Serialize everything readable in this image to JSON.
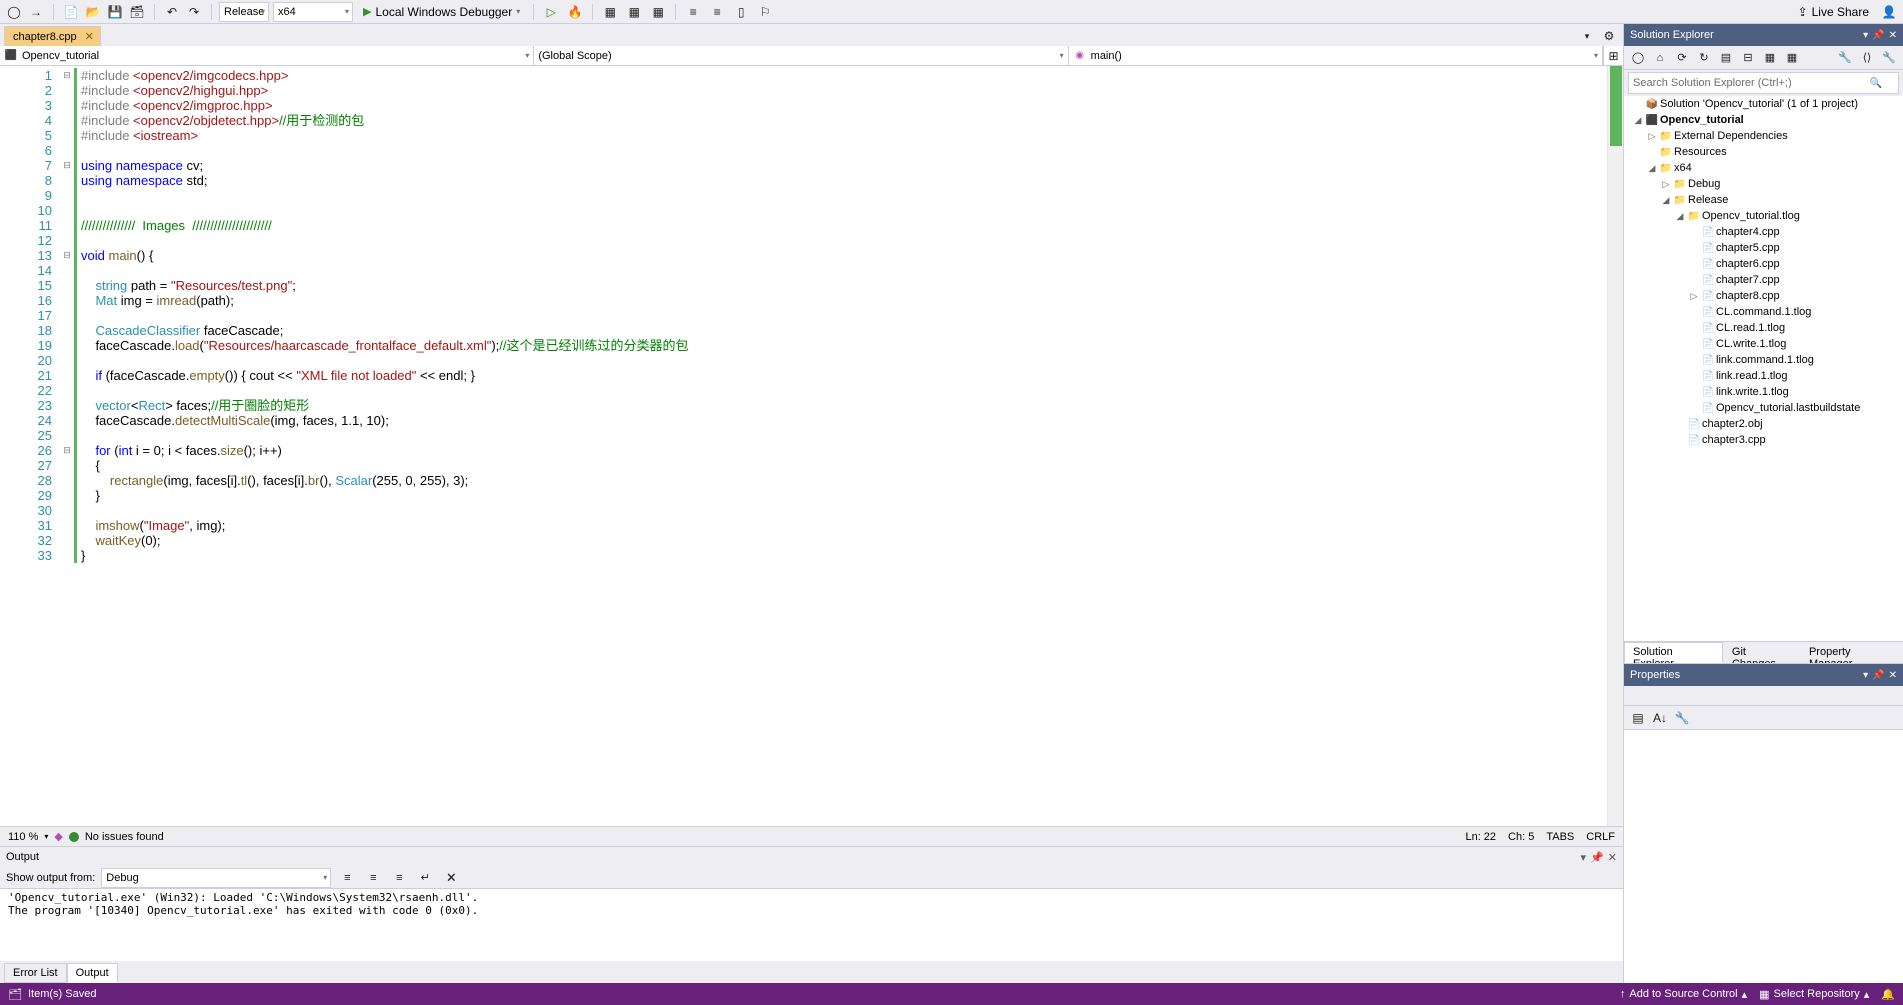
{
  "toolbar": {
    "config": "Release",
    "platform": "x64",
    "debugger_label": "Local Windows Debugger",
    "live_share": "Live Share"
  },
  "tabs": {
    "active_file": "chapter8.cpp"
  },
  "context": {
    "project": "Opencv_tutorial",
    "scope": "(Global Scope)",
    "function": "main()"
  },
  "code": {
    "lines": [
      {
        "n": 1,
        "fold": "⊟",
        "html": "<span class='kw-gray'>#include </span><span class='kw-str'>&lt;opencv2/imgcodecs.hpp&gt;</span>"
      },
      {
        "n": 2,
        "fold": "",
        "html": "<span class='kw-gray'>#include </span><span class='kw-str'>&lt;opencv2/highgui.hpp&gt;</span>"
      },
      {
        "n": 3,
        "fold": "",
        "html": "<span class='kw-gray'>#include </span><span class='kw-str'>&lt;opencv2/imgproc.hpp&gt;</span>"
      },
      {
        "n": 4,
        "fold": "",
        "html": "<span class='kw-gray'>#include </span><span class='kw-str'>&lt;opencv2/objdetect.hpp&gt;</span><span class='kw-comment'>//用于检测的包</span>"
      },
      {
        "n": 5,
        "fold": "",
        "html": "<span class='kw-gray'>#include </span><span class='kw-str'>&lt;iostream&gt;</span>"
      },
      {
        "n": 6,
        "fold": "",
        "html": ""
      },
      {
        "n": 7,
        "fold": "⊟",
        "html": "<span class='kw-blue'>using namespace</span> cv;"
      },
      {
        "n": 8,
        "fold": "",
        "html": "<span class='kw-blue'>using namespace</span> std;"
      },
      {
        "n": 9,
        "fold": "",
        "html": ""
      },
      {
        "n": 10,
        "fold": "",
        "html": ""
      },
      {
        "n": 11,
        "fold": "",
        "html": "<span class='kw-comment'>///////////////  Images  //////////////////////</span>"
      },
      {
        "n": 12,
        "fold": "",
        "html": ""
      },
      {
        "n": 13,
        "fold": "⊟",
        "html": "<span class='kw-blue'>void</span> <span class='kw-func'>main</span>() {"
      },
      {
        "n": 14,
        "fold": "",
        "html": ""
      },
      {
        "n": 15,
        "fold": "",
        "html": "    <span class='kw-type'>string</span> path = <span class='kw-str'>\"Resources/test.png\"</span>;"
      },
      {
        "n": 16,
        "fold": "",
        "html": "    <span class='kw-type'>Mat</span> img = <span class='kw-func'>imread</span>(path);"
      },
      {
        "n": 17,
        "fold": "",
        "html": ""
      },
      {
        "n": 18,
        "fold": "",
        "html": "    <span class='kw-type'>CascadeClassifier</span> faceCascade;"
      },
      {
        "n": 19,
        "fold": "",
        "html": "    faceCascade.<span class='kw-func'>load</span>(<span class='kw-str'>\"Resources/haarcascade_frontalface_default.xml\"</span>);<span class='kw-comment'>//这个是已经训练过的分类器的包</span>"
      },
      {
        "n": 20,
        "fold": "",
        "html": ""
      },
      {
        "n": 21,
        "fold": "",
        "html": "    <span class='kw-blue'>if</span> (faceCascade.<span class='kw-func'>empty</span>()) { cout &lt;&lt; <span class='kw-str'>\"XML file not loaded\"</span> &lt;&lt; endl; }"
      },
      {
        "n": 22,
        "fold": "",
        "html": "    "
      },
      {
        "n": 23,
        "fold": "",
        "html": "    <span class='kw-type'>vector</span>&lt;<span class='kw-type'>Rect</span>&gt; faces;<span class='kw-comment'>//用于圈脸的矩形</span>"
      },
      {
        "n": 24,
        "fold": "",
        "html": "    faceCascade.<span class='kw-func'>detectMultiScale</span>(img, faces, 1.1, 10);"
      },
      {
        "n": 25,
        "fold": "",
        "html": ""
      },
      {
        "n": 26,
        "fold": "⊟",
        "html": "    <span class='kw-blue'>for</span> (<span class='kw-blue'>int</span> i = 0; i &lt; faces.<span class='kw-func'>size</span>(); i++)"
      },
      {
        "n": 27,
        "fold": "",
        "html": "    {"
      },
      {
        "n": 28,
        "fold": "",
        "html": "        <span class='kw-func'>rectangle</span>(img, faces[i].<span class='kw-func'>tl</span>(), faces[i].<span class='kw-func'>br</span>(), <span class='kw-type'>Scalar</span>(255, 0, 255), 3);"
      },
      {
        "n": 29,
        "fold": "",
        "html": "    }"
      },
      {
        "n": 30,
        "fold": "",
        "html": ""
      },
      {
        "n": 31,
        "fold": "",
        "html": "    <span class='kw-func'>imshow</span>(<span class='kw-str'>\"Image\"</span>, img);"
      },
      {
        "n": 32,
        "fold": "",
        "html": "    <span class='kw-func'>waitKey</span>(0);"
      },
      {
        "n": 33,
        "fold": "",
        "html": "}"
      }
    ]
  },
  "editor_status": {
    "zoom": "110 %",
    "issues": "No issues found",
    "ln": "Ln: 22",
    "ch": "Ch: 5",
    "tabs": "TABS",
    "crlf": "CRLF"
  },
  "solution_explorer": {
    "title": "Solution Explorer",
    "search_placeholder": "Search Solution Explorer (Ctrl+;)",
    "tree": [
      {
        "depth": 0,
        "exp": "",
        "ico": "📦",
        "txt": "Solution 'Opencv_tutorial' (1 of 1 project)"
      },
      {
        "depth": 0,
        "exp": "◢",
        "ico": "⬛",
        "txt": "Opencv_tutorial",
        "bold": true
      },
      {
        "depth": 1,
        "exp": "▷",
        "ico": "📁",
        "txt": "External Dependencies",
        "folder": true
      },
      {
        "depth": 1,
        "exp": "",
        "ico": "📁",
        "txt": "Resources",
        "folder": true
      },
      {
        "depth": 1,
        "exp": "◢",
        "ico": "📁",
        "txt": "x64",
        "folder": true
      },
      {
        "depth": 2,
        "exp": "▷",
        "ico": "📁",
        "txt": "Debug",
        "folder": true
      },
      {
        "depth": 2,
        "exp": "◢",
        "ico": "📁",
        "txt": "Release",
        "folder": true
      },
      {
        "depth": 3,
        "exp": "◢",
        "ico": "📁",
        "txt": "Opencv_tutorial.tlog",
        "folder": true
      },
      {
        "depth": 4,
        "exp": "",
        "ico": "📄",
        "txt": "chapter4.cpp"
      },
      {
        "depth": 4,
        "exp": "",
        "ico": "📄",
        "txt": "chapter5.cpp"
      },
      {
        "depth": 4,
        "exp": "",
        "ico": "📄",
        "txt": "chapter6.cpp"
      },
      {
        "depth": 4,
        "exp": "",
        "ico": "📄",
        "txt": "chapter7.cpp"
      },
      {
        "depth": 4,
        "exp": "▷",
        "ico": "📄",
        "txt": "chapter8.cpp"
      },
      {
        "depth": 4,
        "exp": "",
        "ico": "📄",
        "txt": "CL.command.1.tlog"
      },
      {
        "depth": 4,
        "exp": "",
        "ico": "📄",
        "txt": "CL.read.1.tlog"
      },
      {
        "depth": 4,
        "exp": "",
        "ico": "📄",
        "txt": "CL.write.1.tlog"
      },
      {
        "depth": 4,
        "exp": "",
        "ico": "📄",
        "txt": "link.command.1.tlog"
      },
      {
        "depth": 4,
        "exp": "",
        "ico": "📄",
        "txt": "link.read.1.tlog"
      },
      {
        "depth": 4,
        "exp": "",
        "ico": "📄",
        "txt": "link.write.1.tlog"
      },
      {
        "depth": 4,
        "exp": "",
        "ico": "📄",
        "txt": "Opencv_tutorial.lastbuildstate"
      },
      {
        "depth": 3,
        "exp": "",
        "ico": "📄",
        "txt": "chapter2.obj"
      },
      {
        "depth": 3,
        "exp": "",
        "ico": "📄",
        "txt": "chapter3.cpp"
      }
    ]
  },
  "panel_tabs": {
    "t1": "Solution Explorer",
    "t2": "Git Changes",
    "t3": "Property Manager"
  },
  "properties": {
    "title": "Properties"
  },
  "output": {
    "title": "Output",
    "show_from_label": "Show output from:",
    "show_from_value": "Debug",
    "body": "'Opencv_tutorial.exe' (Win32): Loaded 'C:\\Windows\\System32\\rsaenh.dll'.\nThe program '[10340] Opencv_tutorial.exe' has exited with code 0 (0x0)."
  },
  "bottom_tabs": {
    "t1": "Error List",
    "t2": "Output"
  },
  "statusbar": {
    "saved": "Item(s) Saved",
    "src_control": "Add to Source Control",
    "repo": "Select Repository"
  }
}
